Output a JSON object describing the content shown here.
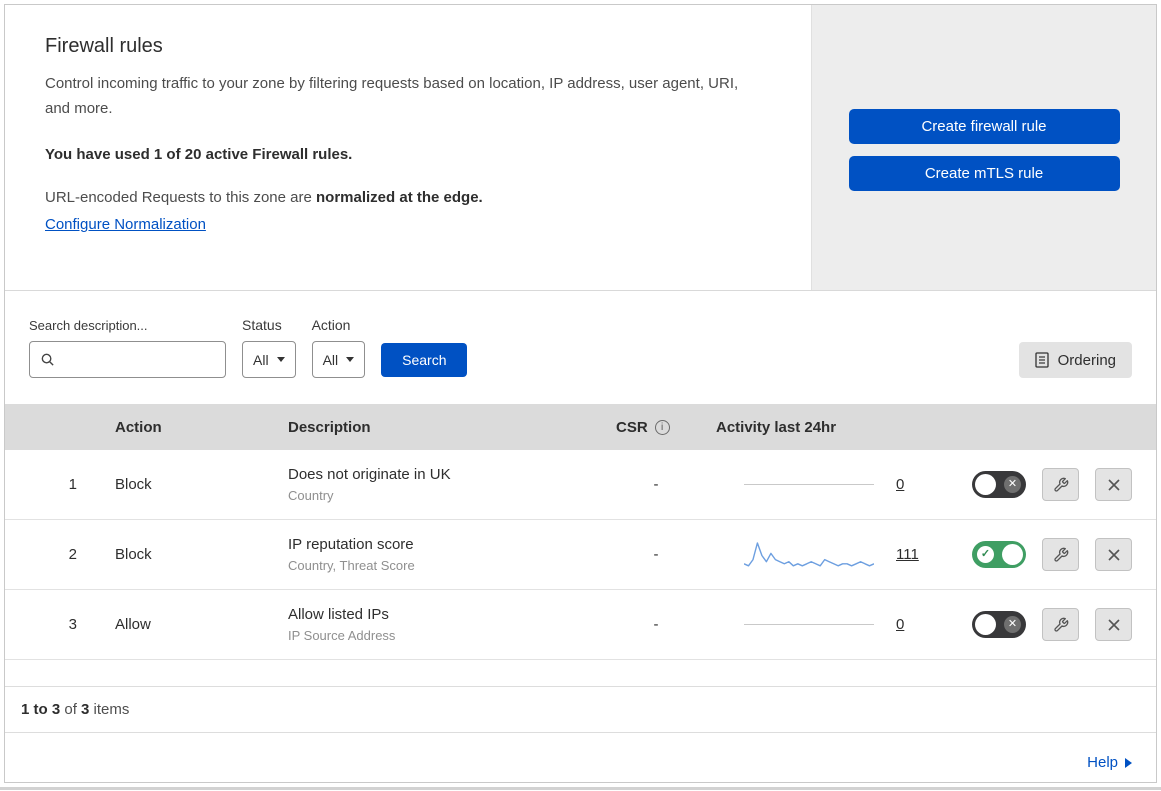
{
  "colors": {
    "primary_blue": "#0051c3",
    "link_blue": "#0051c3",
    "toggle_green": "#3f9e63",
    "sparkline_blue": "#6d9fe0"
  },
  "icons": {
    "search": "search-icon",
    "ordering": "list-icon",
    "csr_info": "info-icon",
    "dropdown": "chevron-down-icon",
    "edit": "wrench-icon",
    "delete": "close-icon",
    "toggle_on": "check-icon",
    "toggle_off": "x-icon",
    "help": "arrow-right-icon"
  },
  "header": {
    "title": "Firewall rules",
    "description": "Control incoming traffic to your zone by filtering requests based on location, IP address, user agent, URI, and more.",
    "usage_text": "You have used 1 of 20 active Firewall rules.",
    "normalization_prefix": "URL-encoded Requests to this zone are ",
    "normalization_bold": "normalized at the edge.",
    "normalization_link": "Configure Normalization",
    "create_firewall_button": "Create firewall rule",
    "create_mtls_button": "Create mTLS rule"
  },
  "filters": {
    "search_label": "Search description...",
    "status_label": "Status",
    "status_value": "All",
    "action_label": "Action",
    "action_value": "All",
    "search_button": "Search",
    "ordering_button": "Ordering"
  },
  "table": {
    "headers": {
      "action": "Action",
      "description": "Description",
      "csr": "CSR",
      "activity": "Activity last 24hr"
    },
    "rows": [
      {
        "index": "1",
        "action": "Block",
        "description": "Does not originate in UK",
        "criteria": "Country",
        "csr": "-",
        "activity_count": "0",
        "enabled": false
      },
      {
        "index": "2",
        "action": "Block",
        "description": "IP reputation score",
        "criteria": "Country, Threat Score",
        "csr": "-",
        "activity_count": "111",
        "enabled": true,
        "sparkline": [
          3,
          2,
          5,
          13,
          7,
          4,
          8,
          5,
          4,
          3,
          4,
          2,
          3,
          2,
          3,
          4,
          3,
          2,
          5,
          4,
          3,
          2,
          3,
          3,
          2,
          3,
          4,
          3,
          2,
          3
        ]
      },
      {
        "index": "3",
        "action": "Allow",
        "description": "Allow listed IPs",
        "criteria": "IP Source Address",
        "csr": "-",
        "activity_count": "0",
        "enabled": false
      }
    ]
  },
  "footer": {
    "range": "1 to 3",
    "of": " of ",
    "total": "3",
    "items": " items",
    "help": "Help"
  }
}
